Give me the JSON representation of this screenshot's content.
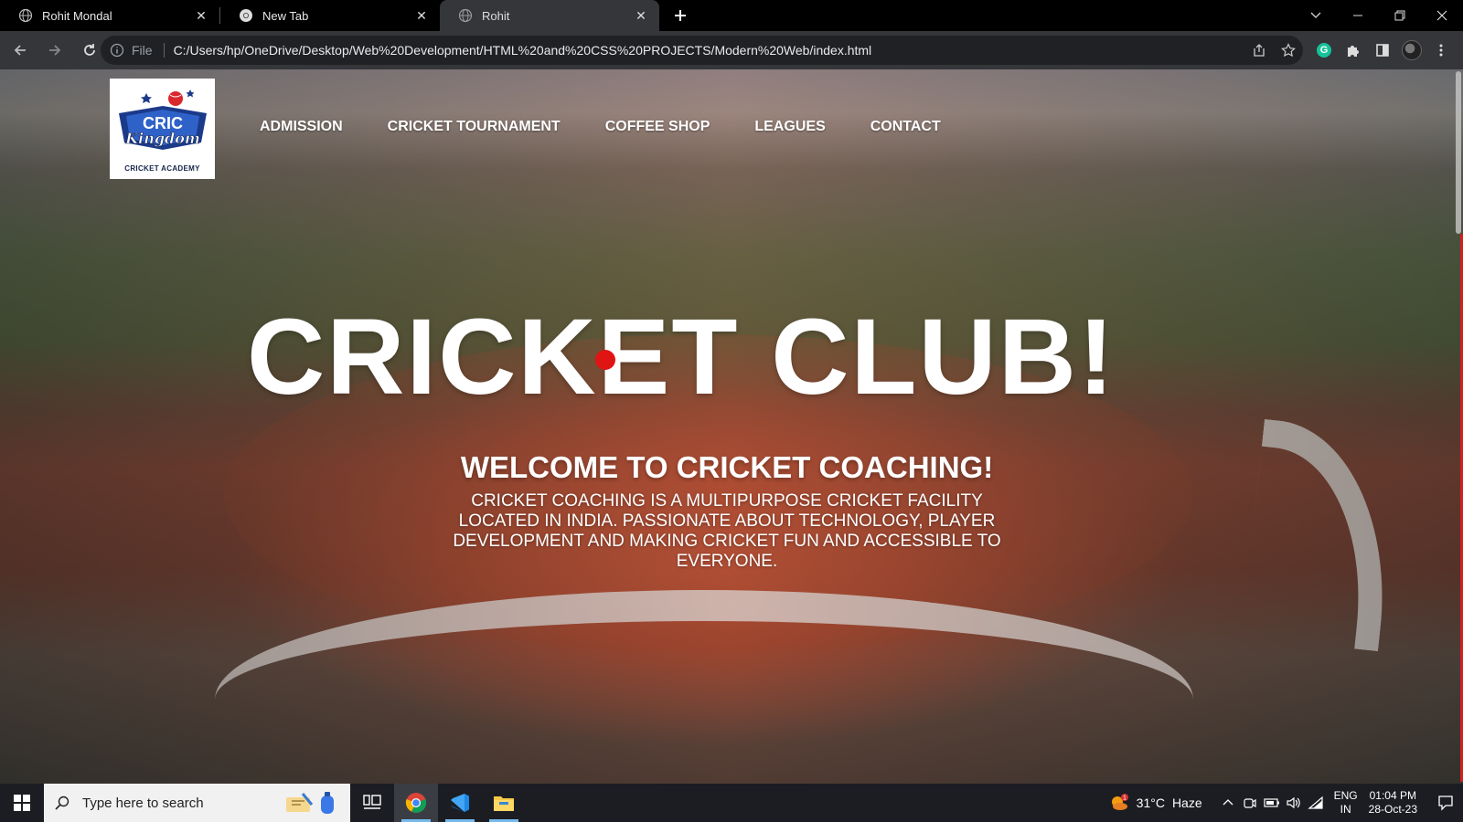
{
  "browser": {
    "tabs": [
      {
        "title": "Rohit Mondal",
        "icon": "globe-icon",
        "active": false
      },
      {
        "title": "New Tab",
        "icon": "chrome-icon",
        "active": false
      },
      {
        "title": "Rohit",
        "icon": "globe-icon",
        "active": true
      }
    ],
    "omnibox": {
      "scheme_label": "File",
      "url": "C:/Users/hp/OneDrive/Desktop/Web%20Development/HTML%20and%20CSS%20PROJECTS/Modern%20Web/index.html"
    },
    "colors": {
      "tabstrip": "#000000",
      "toolbar": "#35363a",
      "omnibox": "#202124"
    }
  },
  "site": {
    "logo": {
      "line1": "CRIC",
      "line2": "Kingdom",
      "tagline": "CRICKET ACADEMY"
    },
    "nav": [
      {
        "label": "ADMISSION"
      },
      {
        "label": "CRICKET TOURNAMENT"
      },
      {
        "label": "COFFEE SHOP"
      },
      {
        "label": "LEAGUES"
      },
      {
        "label": "CONTACT"
      }
    ],
    "hero": {
      "title": "CRICKET CLUB!",
      "subtitle": "WELCOME TO CRICKET COACHING!",
      "description": "CRICKET COACHING IS A MULTIPURPOSE CRICKET FACILITY LOCATED IN INDIA. PASSIONATE ABOUT TECHNOLOGY, PLAYER DEVELOPMENT AND MAKING CRICKET FUN AND ACCESSIBLE TO EVERYONE."
    },
    "colors": {
      "accent_dot": "#e11414",
      "scroll_accent": "#d21f1f"
    }
  },
  "taskbar": {
    "search_placeholder": "Type here to search",
    "apps": [
      {
        "name": "task-view-icon"
      },
      {
        "name": "chrome-icon"
      },
      {
        "name": "vscode-icon"
      },
      {
        "name": "file-explorer-icon"
      }
    ],
    "weather": {
      "temp": "31°C",
      "desc": "Haze",
      "badge": "1"
    },
    "language": {
      "line1": "ENG",
      "line2": "IN"
    },
    "clock": {
      "time": "01:04 PM",
      "date": "28-Oct-23"
    }
  }
}
